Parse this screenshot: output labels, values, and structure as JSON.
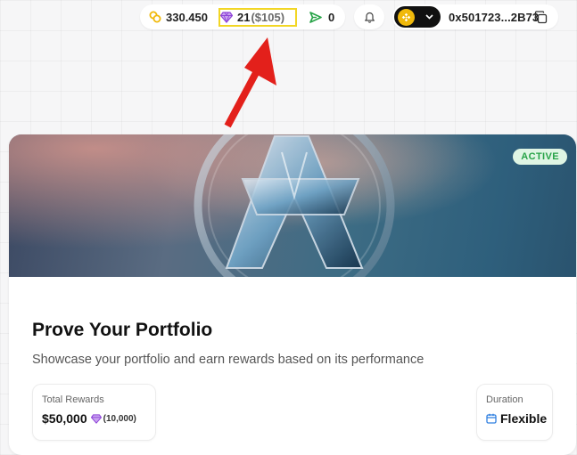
{
  "header": {
    "coins": "330.450",
    "gems": "21",
    "gems_usd": "($105)",
    "sends": "0",
    "wallet_address": "0x501723...2B73"
  },
  "quest": {
    "status": "ACTIVE",
    "title": "Prove Your Portfolio",
    "subtitle": "Showcase your portfolio and earn rewards based on its performance",
    "rewards_label": "Total Rewards",
    "rewards_value": "$50,000",
    "rewards_gems_open": "(",
    "rewards_gems": "(10,000)",
    "duration_label": "Duration",
    "duration_value": "Flexible"
  },
  "colors": {
    "coin": "#f0b90b",
    "gem": "#8e44d8",
    "send": "#27a347",
    "highlight": "#f2d625",
    "arrow": "#e3201b",
    "active_badge_bg": "#dff5e4",
    "active_badge_text": "#27a347"
  },
  "icons": [
    "coins-icon",
    "diamond-icon",
    "send-icon",
    "bell-icon",
    "bnb-logo-icon",
    "chevron-down-icon",
    "copy-icon",
    "calendar-icon"
  ]
}
